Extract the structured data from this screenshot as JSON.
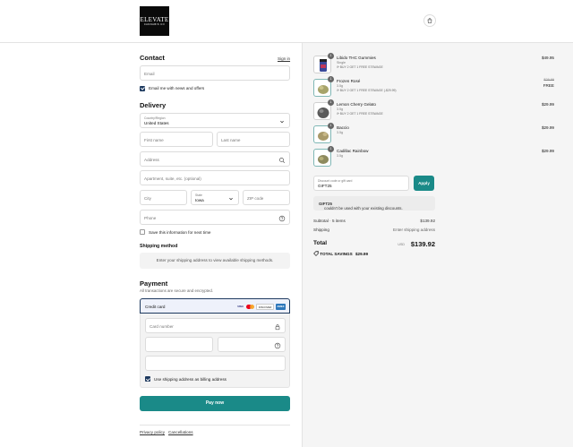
{
  "header": {
    "logo_line1": "ELEVATE",
    "logo_line2": "CANNABIS CO",
    "cart_icon": "shopping-bag-icon"
  },
  "contact": {
    "title": "Contact",
    "sign_in": "Sign in",
    "email_placeholder": "Email",
    "news_label": "Email me with news and offers",
    "news_checked": true
  },
  "delivery": {
    "title": "Delivery",
    "country_label": "Country/Region",
    "country_value": "United States",
    "first_name": "First name",
    "last_name": "Last name",
    "address": "Address",
    "apartment": "Apartment, suite, etc. (optional)",
    "city": "City",
    "state_label": "State",
    "state_value": "Iowa",
    "zip": "ZIP code",
    "phone": "Phone",
    "save_info": "Save this information for next time",
    "save_checked": false
  },
  "shipping": {
    "title": "Shipping method",
    "message": "Enter your shipping address to view available shipping methods."
  },
  "payment": {
    "title": "Payment",
    "subtitle": "All transactions are secure and encrypted.",
    "method": "Credit card",
    "card_brands": [
      "VISA",
      "MC",
      "DISCOVER",
      "AMEX"
    ],
    "card_number": "Card number",
    "billing_label": "Use shipping address as billing address",
    "billing_checked": true,
    "pay_button": "Pay now"
  },
  "footer": {
    "links": [
      "Privacy policy",
      "Cancellations"
    ]
  },
  "order": {
    "items": [
      {
        "name": "Libido THC Gummies",
        "variant": "Single",
        "promo": "BUY 2 GET 1 FREE S7SWAGE",
        "price": "$49.95",
        "qty": "1",
        "color": "#3a4a9a"
      },
      {
        "name": "Frozen Rosé",
        "variant": "3.5g",
        "promo": "BUY 2 GET 1 FREE S7SWAGE (-$29.99)",
        "price_old": "$29.99",
        "price": "FREE",
        "qty": "1",
        "color": "#a7a36a"
      },
      {
        "name": "Lemon Cherry Gelato",
        "variant": "3.5g",
        "promo": "BUY 2 GET 1 FREE S7SWAGE",
        "price": "$29.99",
        "qty": "1",
        "color": "#6b6b6b"
      },
      {
        "name": "Baccio",
        "variant": "3.5g",
        "promo": "",
        "price": "$29.99",
        "qty": "1",
        "color": "#a99a6a"
      },
      {
        "name": "Cadillac Rainbow",
        "variant": "3.5g",
        "promo": "",
        "price": "$29.99",
        "qty": "1",
        "color": "#8e8a5e"
      }
    ],
    "discount_label": "Discount code or gift card",
    "discount_value": "GIFT25",
    "apply": "Apply",
    "error_code": "GIFT25",
    "error_text": " couldn't be used with your existing discounts.",
    "subtotal_label": "Subtotal · 5 items",
    "subtotal_value": "$139.92",
    "shipping_label": "Shipping",
    "shipping_value": "Enter shipping address",
    "total_label": "Total",
    "currency": "USD",
    "total_value": "$139.92",
    "savings_label": "TOTAL SAVINGS",
    "savings_value": "$29.99"
  },
  "colors": {
    "accent": "#1a8a88",
    "selected_border": "#1e3a5f"
  }
}
